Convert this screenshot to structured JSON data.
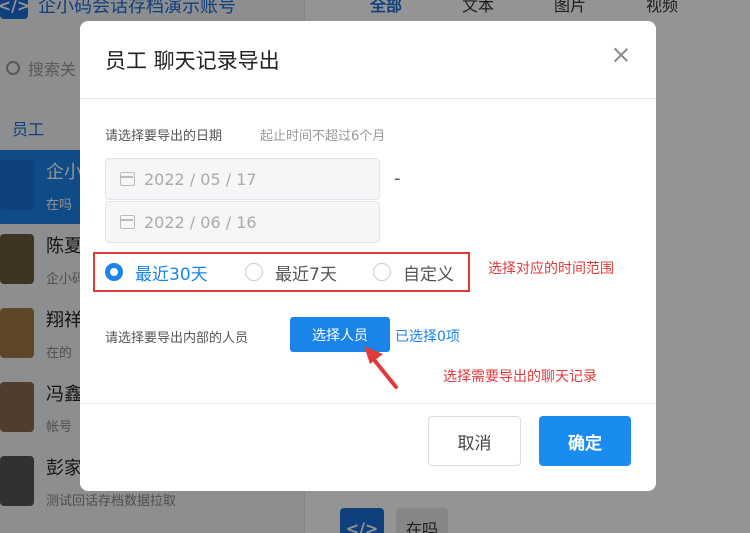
{
  "app": {
    "title": "企小码会话存档演示账号",
    "logo_text": "</>",
    "search_placeholder": "搜索关",
    "group_label": "员工",
    "tabs": [
      "全部",
      "文本",
      "图片",
      "视频"
    ],
    "contacts": [
      {
        "name": "企小",
        "sub": "在吗"
      },
      {
        "name": "陈夏",
        "sub": "企小码"
      },
      {
        "name": "翔祥",
        "sub": "在的"
      },
      {
        "name": "冯鑫",
        "sub": "帐号"
      },
      {
        "name": "彭家",
        "sub": "测试回话存档数据拉取"
      }
    ],
    "message_bubble": "在吗"
  },
  "dialog": {
    "title": "员工 聊天记录导出",
    "date_label": "请选择要导出的日期",
    "date_hint": "起止时间不超过6个月",
    "start_date": "2022 / 05 / 17",
    "end_date": "2022 / 06 / 16",
    "range_separator": "-",
    "ranges": [
      {
        "label": "最近30天",
        "selected": true
      },
      {
        "label": "最近7天",
        "selected": false
      },
      {
        "label": "自定义",
        "selected": false
      }
    ],
    "range_annotation": "选择对应的时间范围",
    "member_label": "请选择要导出内部的人员",
    "pick_button": "选择人员",
    "selected_count": "已选择0项",
    "member_annotation": "选择需要导出的聊天记录",
    "cancel_button": "取消",
    "confirm_button": "确定"
  },
  "colors": {
    "primary": "#1a84e8",
    "annotation_red": "#e23a3a",
    "mask": "rgba(0,0,0,0.42)"
  }
}
